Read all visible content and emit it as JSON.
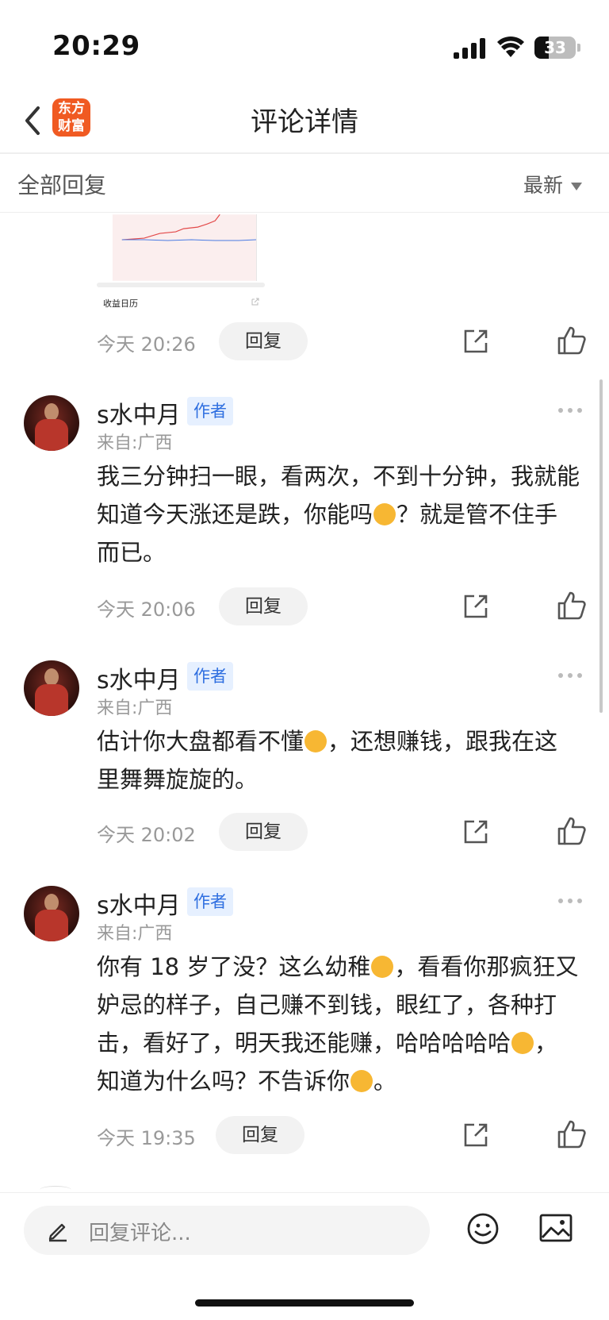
{
  "status_bar": {
    "time": "20:29",
    "battery": "33"
  },
  "nav": {
    "title": "评论详情",
    "logo_line1": "东方",
    "logo_line2": "财富"
  },
  "filter": {
    "label": "全部回复",
    "sort": "最新"
  },
  "chart_thumb": {
    "caption": "收益日历"
  },
  "top_actions": {
    "time": "今天 20:26",
    "reply": "回复"
  },
  "comments": [
    {
      "name": "s水中月",
      "badge": "作者",
      "location": "来自:广西",
      "text_parts": [
        "我三分钟扫一眼，看两次，不到十分钟，我就能知道今天涨还是跌，你能吗",
        "？就是管不住手而已。"
      ],
      "time": "今天 20:06",
      "reply": "回复"
    },
    {
      "name": "s水中月",
      "badge": "作者",
      "location": "来自:广西",
      "text_parts": [
        "估计你大盘都看不懂",
        "，还想赚钱，跟我在这里舞舞旋旋的。"
      ],
      "time": "今天 20:02",
      "reply": "回复"
    },
    {
      "name": "s水中月",
      "badge": "作者",
      "location": "来自:广西",
      "text_parts": [
        "你有 18 岁了没？这么幼稚",
        "，看看你那疯狂又妒忌的样子，自己赚不到钱，眼红了，各种打击，看好了，明天我还能赚，哈哈哈哈哈",
        "，知道为什么吗？不告诉你",
        "。"
      ],
      "time": "今天 19:35",
      "reply": "回复"
    }
  ],
  "input": {
    "placeholder": "回复评论..."
  },
  "icons": {
    "back": "chevron-left-icon",
    "share": "share-icon",
    "like": "thumbs-up-icon",
    "more": "more-horizontal-icon",
    "pencil": "pencil-icon",
    "emoji": "smiley-icon",
    "image": "image-icon"
  },
  "colors": {
    "brand": "#f05a22",
    "badge_text": "#2f6fe0",
    "badge_bg": "#e6f0ff"
  }
}
